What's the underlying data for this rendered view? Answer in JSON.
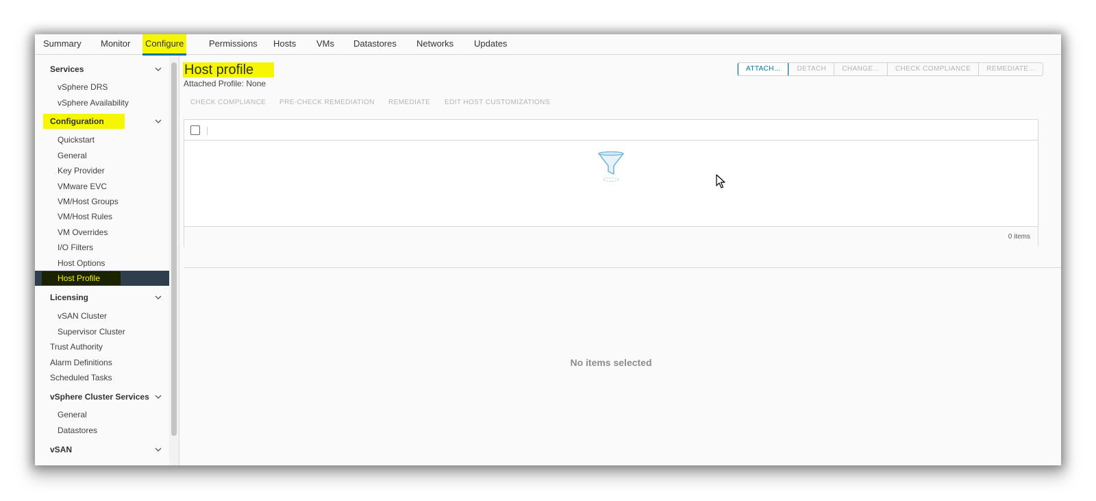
{
  "tabs": [
    {
      "label": "Summary"
    },
    {
      "label": "Monitor"
    },
    {
      "label": "Configure"
    },
    {
      "label": "Permissions"
    },
    {
      "label": "Hosts"
    },
    {
      "label": "VMs"
    },
    {
      "label": "Datastores"
    },
    {
      "label": "Networks"
    },
    {
      "label": "Updates"
    }
  ],
  "sidebar": {
    "services": {
      "label": "Services",
      "items": [
        "vSphere DRS",
        "vSphere Availability"
      ]
    },
    "configuration": {
      "label": "Configuration",
      "items": [
        "Quickstart",
        "General",
        "Key Provider",
        "VMware EVC",
        "VM/Host Groups",
        "VM/Host Rules",
        "VM Overrides",
        "I/O Filters",
        "Host Options",
        "Host Profile"
      ]
    },
    "licensing": {
      "label": "Licensing",
      "items": [
        "vSAN Cluster",
        "Supervisor Cluster"
      ]
    },
    "plain": [
      "Trust Authority",
      "Alarm Definitions",
      "Scheduled Tasks"
    ],
    "cluster_services": {
      "label": "vSphere Cluster Services",
      "items": [
        "General",
        "Datastores"
      ]
    },
    "vsan": {
      "label": "vSAN"
    }
  },
  "main": {
    "title": "Host profile",
    "subtitle": "Attached Profile: None",
    "top_buttons": [
      "ATTACH...",
      "DETACH",
      "CHANGE...",
      "CHECK COMPLIANCE",
      "REMEDIATE..."
    ],
    "actions": [
      "CHECK COMPLIANCE",
      "PRE-CHECK REMEDIATION",
      "REMEDIATE",
      "EDIT HOST CUSTOMIZATIONS"
    ],
    "grid_count": "0 items",
    "empty_message": "No items selected"
  },
  "colors": {
    "highlight": "#f6f600",
    "accent": "#0072a3",
    "selected_bg": "#2f3e4c"
  }
}
